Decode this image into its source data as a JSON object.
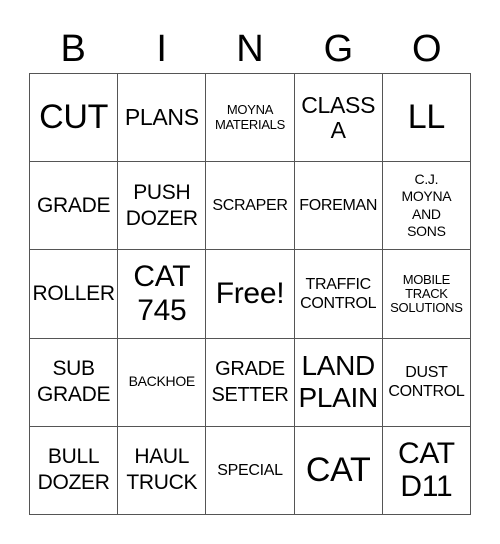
{
  "header": {
    "letters": [
      "B",
      "I",
      "N",
      "G",
      "O"
    ]
  },
  "card": {
    "rows": [
      [
        "CUT",
        "PLANS",
        "MOYNA\nMATERIALS",
        "CLASS\nA",
        "LL"
      ],
      [
        "GRADE",
        "PUSH\nDOZER",
        "SCRAPER",
        "FOREMAN",
        "C.J.\nMOYNA\nAND\nSONS"
      ],
      [
        "ROLLER",
        "CAT\n745",
        "Free!",
        "TRAFFIC\nCONTROL",
        "MOBILE\nTRACK\nSOLUTIONS"
      ],
      [
        "SUB\nGRADE",
        "BACKHOE",
        "GRADE\nSETTER",
        "LAND\nPLAIN",
        "DUST\nCONTROL"
      ],
      [
        "BULL\nDOZER",
        "HAUL\nTRUCK",
        "SPECIAL",
        "CAT",
        "CAT\nD11"
      ]
    ],
    "free_space": "Free!"
  }
}
